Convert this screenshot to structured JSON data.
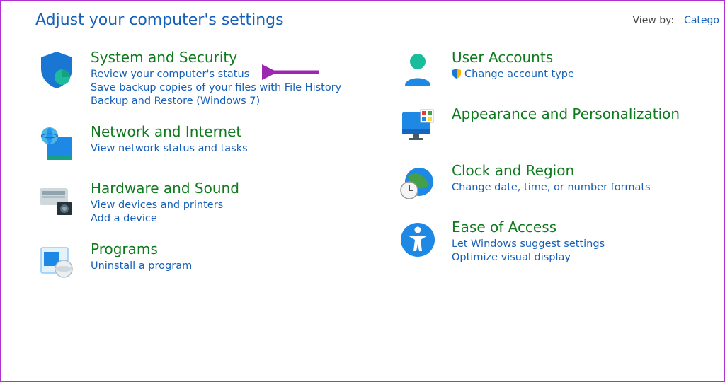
{
  "header": {
    "title": "Adjust your computer's settings",
    "view_by_label": "View by:",
    "view_by_value": "Catego"
  },
  "categories_left": [
    {
      "name": "system-security",
      "title": "System and Security",
      "links": [
        "Review your computer's status",
        "Save backup copies of your files with File History",
        "Backup and Restore (Windows 7)"
      ]
    },
    {
      "name": "network-internet",
      "title": "Network and Internet",
      "links": [
        "View network status and tasks"
      ]
    },
    {
      "name": "hardware-sound",
      "title": "Hardware and Sound",
      "links": [
        "View devices and printers",
        "Add a device"
      ]
    },
    {
      "name": "programs",
      "title": "Programs",
      "links": [
        "Uninstall a program"
      ]
    }
  ],
  "categories_right": [
    {
      "name": "user-accounts",
      "title": "User Accounts",
      "links": [
        {
          "shield": true,
          "text": "Change account type"
        }
      ]
    },
    {
      "name": "appearance",
      "title": "Appearance and Personalization",
      "links": []
    },
    {
      "name": "clock-region",
      "title": "Clock and Region",
      "links": [
        "Change date, time, or number formats"
      ]
    },
    {
      "name": "ease-of-access",
      "title": "Ease of Access",
      "links": [
        "Let Windows suggest settings",
        "Optimize visual display"
      ]
    }
  ]
}
